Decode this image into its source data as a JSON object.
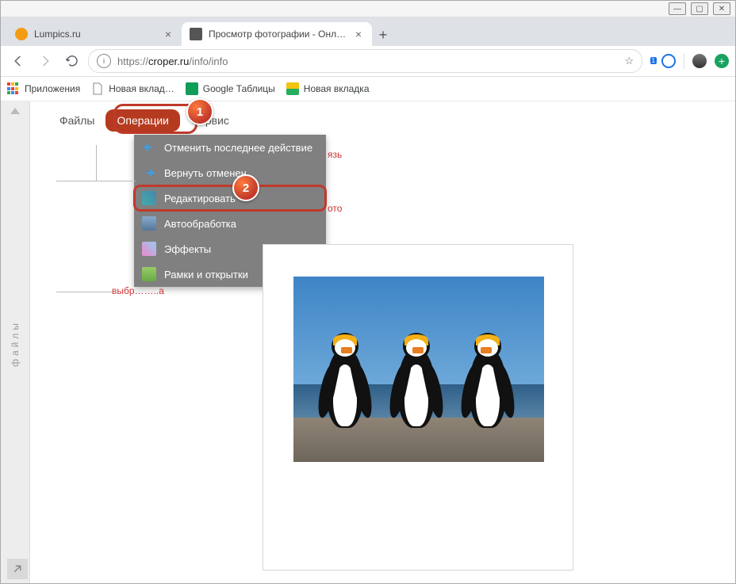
{
  "window_controls": {
    "min": "—",
    "max": "▢",
    "close": "✕"
  },
  "tabs": [
    {
      "title": "Lumpics.ru",
      "favicon_color": "#f39c12",
      "active": false
    },
    {
      "title": "Просмотр фотографии - Онлай",
      "favicon_color": "#555",
      "active": true
    }
  ],
  "newtab": "+",
  "toolbar": {
    "url_scheme": "https://",
    "url_host": "croper.ru",
    "url_path": "/info/info",
    "star": "☆"
  },
  "bookmarks": [
    {
      "label": "Приложения",
      "icon": "apps"
    },
    {
      "label": "Новая вклад…",
      "icon": "page"
    },
    {
      "label": "Google Таблицы",
      "icon": "sheets"
    },
    {
      "label": "Новая вкладка",
      "icon": "photo"
    }
  ],
  "sidebar_label": "файлы",
  "editor_menu": {
    "files": "Файлы",
    "operations": "Операции",
    "service": "Сервис"
  },
  "dropdown": [
    {
      "label": "Отменить последнее действие",
      "icon": "undo"
    },
    {
      "label": "Вернуть отменен",
      "icon": "redo"
    },
    {
      "label": "Редактировать",
      "icon": "edit",
      "hl": true
    },
    {
      "label": "Автообработка",
      "icon": "auto"
    },
    {
      "label": "Эффекты",
      "icon": "fx"
    },
    {
      "label": "Рамки и открытки",
      "icon": "frame"
    }
  ],
  "partial_labels": {
    "top": "язь",
    "mid": "ото",
    "bottom": "выбр……..а"
  },
  "badges": {
    "b1": "1",
    "b2": "2"
  },
  "ext_colors": {
    "opera": "#d42e12",
    "globe": "#1a73e8",
    "avatar": "#444",
    "plus": "#1aa260"
  }
}
